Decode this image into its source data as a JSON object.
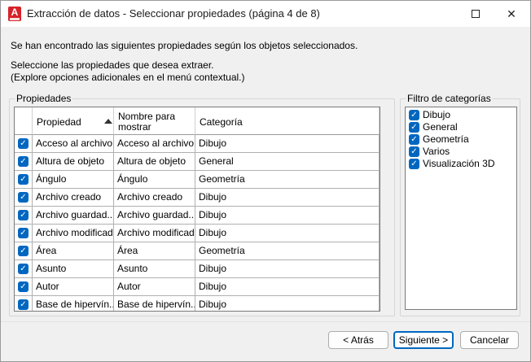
{
  "window": {
    "title": "Extracción de datos - Seleccionar propiedades (página 4 de 8)",
    "app_icon_letter": "A",
    "controls": {
      "help": "?",
      "close": "✕"
    }
  },
  "intro": {
    "line1": "Se han encontrado las siguientes propiedades según los objetos seleccionados.",
    "line2": "Seleccione las propiedades que desea extraer.",
    "line3": "(Explore opciones adicionales en el menú contextual.)"
  },
  "properties": {
    "group_label": "Propiedades",
    "columns": {
      "propiedad": "Propiedad",
      "nombre_line1": "Nombre para",
      "nombre_line2": "mostrar",
      "categoria": "Categoría"
    },
    "rows": [
      {
        "checked": true,
        "propiedad": "Acceso al archivo",
        "nombre": "Acceso al archivo",
        "categoria": "Dibujo"
      },
      {
        "checked": true,
        "propiedad": "Altura de objeto",
        "nombre": "Altura de objeto",
        "categoria": "General"
      },
      {
        "checked": true,
        "propiedad": "Ángulo",
        "nombre": "Ángulo",
        "categoria": "Geometría"
      },
      {
        "checked": true,
        "propiedad": "Archivo creado",
        "nombre": "Archivo creado",
        "categoria": "Dibujo"
      },
      {
        "checked": true,
        "propiedad": "Archivo guardad...",
        "nombre": "Archivo guardad...",
        "categoria": "Dibujo"
      },
      {
        "checked": true,
        "propiedad": "Archivo modificado",
        "nombre": "Archivo modificado",
        "categoria": "Dibujo"
      },
      {
        "checked": true,
        "propiedad": "Área",
        "nombre": "Área",
        "categoria": "Geometría"
      },
      {
        "checked": true,
        "propiedad": "Asunto",
        "nombre": "Asunto",
        "categoria": "Dibujo"
      },
      {
        "checked": true,
        "propiedad": "Autor",
        "nombre": "Autor",
        "categoria": "Dibujo"
      },
      {
        "checked": true,
        "propiedad": "Base de hipervín...",
        "nombre": "Base de hipervín...",
        "categoria": "Dibujo"
      }
    ]
  },
  "filter": {
    "group_label": "Filtro de categorías",
    "items": [
      {
        "checked": true,
        "label": "Dibujo"
      },
      {
        "checked": true,
        "label": "General"
      },
      {
        "checked": true,
        "label": "Geometría"
      },
      {
        "checked": true,
        "label": "Varios"
      },
      {
        "checked": true,
        "label": "Visualización 3D"
      }
    ]
  },
  "buttons": {
    "back": "< Atrás",
    "next": "Siguiente >",
    "cancel": "Cancelar"
  },
  "colors": {
    "accent": "#0067c0",
    "app_icon": "#d6232a"
  }
}
